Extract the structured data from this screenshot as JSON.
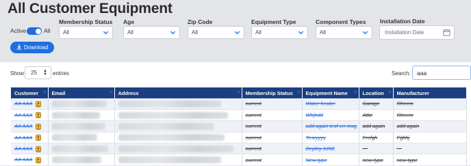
{
  "page": {
    "title": "All Customer Equipment"
  },
  "filters": {
    "active_label": "Active",
    "all_label": "All",
    "download_label": "Download",
    "membership_status": {
      "label": "Membership Status",
      "value": "All"
    },
    "age": {
      "label": "Age",
      "value": "All"
    },
    "zip_code": {
      "label": "Zip Code",
      "value": "All"
    },
    "equipment_type": {
      "label": "Equipment Type",
      "value": "All"
    },
    "component_types": {
      "label": "Component Types",
      "value": "All"
    },
    "installation_date": {
      "label": "Installation Date",
      "placeholder": "Installation Date"
    }
  },
  "table_controls": {
    "show_label": "Show",
    "entries_value": "25",
    "entries_label": "entries",
    "search_label": "Search:",
    "search_value": "aaa"
  },
  "table": {
    "headers": [
      "Customer",
      "Email",
      "Address",
      "Membership Status",
      "Equipment Name",
      "Location",
      "Manufacturer"
    ],
    "rows": [
      {
        "customer": "AA AAA",
        "status": "current",
        "equipment": "Water heater",
        "location": "Garage",
        "manufacturer": "Rheem"
      },
      {
        "customer": "AA AAA",
        "status": "current",
        "equipment": "Whjhdd",
        "location": "Attic",
        "manufacturer": "Rheem"
      },
      {
        "customer": "AA AAA",
        "status": "current",
        "equipment": "add again tesf err msg",
        "location": "add again",
        "manufacturer": "add again"
      },
      {
        "customer": "AA AAA",
        "status": "current",
        "equipment": "Tesryyyy",
        "location": "Frefgh",
        "manufacturer": "Fghhj"
      },
      {
        "customer": "AA AAA",
        "status": "current",
        "equipment": "Deploy 1208",
        "location": "---",
        "manufacturer": "---"
      },
      {
        "customer": "AA AAA",
        "status": "current",
        "equipment": "New type",
        "location": "new-type",
        "manufacturer": "new-type"
      }
    ]
  },
  "colors": {
    "accent": "#1f6fe0",
    "header_bg": "#1c3f82",
    "page_bg": "#e3e5e8"
  },
  "icons": [
    "chevron-down-icon",
    "download-icon",
    "calendar-icon",
    "sort-icon",
    "member-badge-icon"
  ]
}
